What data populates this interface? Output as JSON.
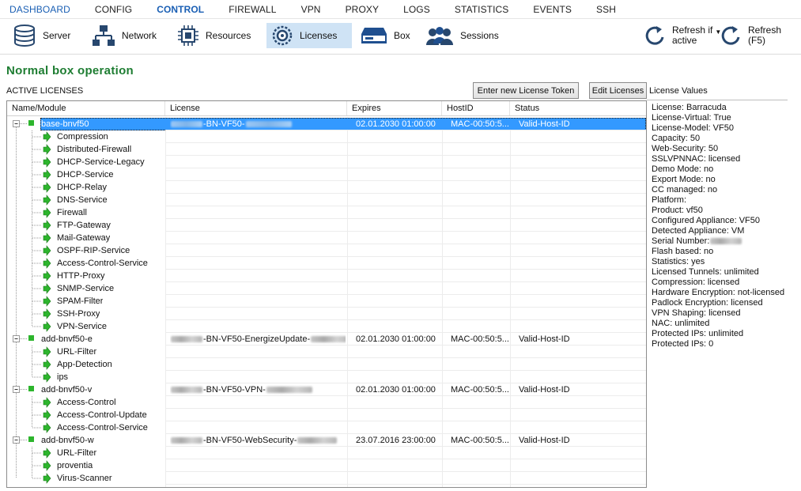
{
  "top_nav": [
    {
      "label": "DASHBOARD",
      "state": "link"
    },
    {
      "label": "CONFIG",
      "state": "normal"
    },
    {
      "label": "CONTROL",
      "state": "current"
    },
    {
      "label": "FIREWALL",
      "state": "normal"
    },
    {
      "label": "VPN",
      "state": "normal"
    },
    {
      "label": "PROXY",
      "state": "normal"
    },
    {
      "label": "LOGS",
      "state": "normal"
    },
    {
      "label": "STATISTICS",
      "state": "normal"
    },
    {
      "label": "EVENTS",
      "state": "normal"
    },
    {
      "label": "SSH",
      "state": "normal"
    }
  ],
  "toolbar": {
    "server": "Server",
    "network": "Network",
    "resources": "Resources",
    "licenses": "Licenses",
    "box": "Box",
    "sessions": "Sessions",
    "refresh_if_active_1": "Refresh if",
    "refresh_if_active_2": "active",
    "refresh_1": "Refresh",
    "refresh_2": "(F5)"
  },
  "status_title": "Normal box operation",
  "active_licenses_label": "ACTIVE LICENSES",
  "buttons": {
    "enter_token": "Enter new License Token",
    "edit_licenses": "Edit Licenses"
  },
  "grid": {
    "columns": [
      "Name/Module",
      "License",
      "Expires",
      "HostID",
      "Status"
    ],
    "rows": [
      {
        "level": 0,
        "name": "base-bnvf50",
        "license_pre": "",
        "license_text": "-BN-VF50-",
        "license_post": true,
        "expires": "02.01.2030 01:00:00",
        "hostid": "MAC-00:50:5...",
        "status": "Valid-Host-ID",
        "selected": true
      },
      {
        "level": 1,
        "name": "Compression"
      },
      {
        "level": 1,
        "name": "Distributed-Firewall"
      },
      {
        "level": 1,
        "name": "DHCP-Service-Legacy"
      },
      {
        "level": 1,
        "name": "DHCP-Service"
      },
      {
        "level": 1,
        "name": "DHCP-Relay"
      },
      {
        "level": 1,
        "name": "DNS-Service"
      },
      {
        "level": 1,
        "name": "Firewall"
      },
      {
        "level": 1,
        "name": "FTP-Gateway"
      },
      {
        "level": 1,
        "name": "Mail-Gateway"
      },
      {
        "level": 1,
        "name": "OSPF-RIP-Service"
      },
      {
        "level": 1,
        "name": "Access-Control-Service"
      },
      {
        "level": 1,
        "name": "HTTP-Proxy"
      },
      {
        "level": 1,
        "name": "SNMP-Service"
      },
      {
        "level": 1,
        "name": "SPAM-Filter"
      },
      {
        "level": 1,
        "name": "SSH-Proxy"
      },
      {
        "level": 1,
        "name": "VPN-Service"
      },
      {
        "level": 0,
        "name": "add-bnvf50-e",
        "license_text": "-BN-VF50-EnergizeUpdate-",
        "license_post": true,
        "expires": "02.01.2030 01:00:00",
        "hostid": "MAC-00:50:5...",
        "status": "Valid-Host-ID"
      },
      {
        "level": 1,
        "name": "URL-Filter"
      },
      {
        "level": 1,
        "name": "App-Detection"
      },
      {
        "level": 1,
        "name": "ips"
      },
      {
        "level": 0,
        "name": "add-bnvf50-v",
        "license_text": "-BN-VF50-VPN-",
        "license_post": true,
        "expires": "02.01.2030 01:00:00",
        "hostid": "MAC-00:50:5...",
        "status": "Valid-Host-ID"
      },
      {
        "level": 1,
        "name": "Access-Control"
      },
      {
        "level": 1,
        "name": "Access-Control-Update"
      },
      {
        "level": 1,
        "name": "Access-Control-Service"
      },
      {
        "level": 0,
        "name": "add-bnvf50-w",
        "license_text": "-BN-VF50-WebSecurity-",
        "license_post": true,
        "expires": "23.07.2016 23:00:00",
        "hostid": "MAC-00:50:5...",
        "status": "Valid-Host-ID"
      },
      {
        "level": 1,
        "name": "URL-Filter"
      },
      {
        "level": 1,
        "name": "proventia"
      },
      {
        "level": 1,
        "name": "Virus-Scanner"
      }
    ]
  },
  "license_values": {
    "heading": "License Values",
    "items": [
      "License: Barracuda",
      "License-Virtual: True",
      "License-Model: VF50",
      "Capacity: 50",
      "Web-Security: 50",
      "SSLVPNNAC: licensed",
      "Demo Mode: no",
      "Export Mode: no",
      "CC managed: no",
      "Platform:",
      "Product: vf50",
      "Configured Appliance: VF50",
      "Detected Appliance: VM",
      "Serial Number:",
      "Flash based: no",
      "Statistics: yes",
      "Licensed Tunnels: unlimited",
      "Compression: licensed",
      "Hardware Encryption: not-licensed",
      "Padlock Encryption: licensed",
      "VPN Shaping: licensed",
      "NAC: unlimited",
      "Protected IPs: unlimited",
      "Protected IPs: 0"
    ]
  },
  "colors": {
    "accent_blue": "#1a5fb4",
    "status_green": "#1e7d32",
    "selection": "#3399ff",
    "selected_tool": "#cfe3f5",
    "tree_bullet_green": "#2db52d"
  }
}
